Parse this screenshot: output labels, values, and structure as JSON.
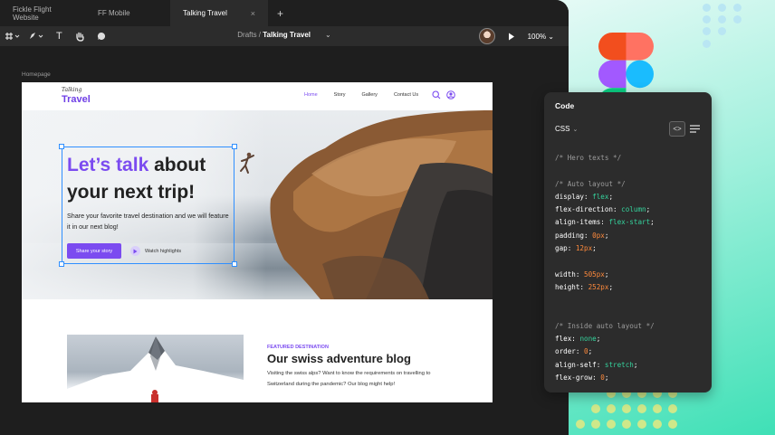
{
  "tabs": [
    {
      "label": "Fickle Flight Website"
    },
    {
      "label": "FF Mobile"
    },
    {
      "label": "Talking Travel",
      "active": true,
      "close": "×"
    }
  ],
  "tab_add": "+",
  "toolbar": {
    "breadcrumb_folder": "Drafts / ",
    "breadcrumb_file": "Talking Travel",
    "breadcrumb_chevron": "⌄",
    "zoom": "100%",
    "zoom_chevron": "⌄",
    "icons": [
      "frame-tool-icon",
      "pen-tool-icon",
      "text-tool-icon",
      "hand-tool-icon",
      "comment-tool-icon"
    ],
    "text_tool": "T"
  },
  "canvas": {
    "frame_label": "Homepage"
  },
  "site": {
    "logo_script": "Talking",
    "logo_main": "Travel",
    "nav": [
      "Home",
      "Story",
      "Gallery",
      "Contact Us"
    ],
    "hero_title_accent": "Let’s talk",
    "hero_title_rest": " about",
    "hero_title_line2": "your next trip!",
    "hero_subtitle": "Share your favorite travel destination and we will feature it in our next blog!",
    "cta_primary": "Share your story",
    "cta_secondary": "Watch highlights",
    "featured_tag": "FEATURED DESTINATION",
    "featured_title": "Our swiss adventure blog",
    "featured_body": "Visiting the swiss alps? Want to know the requirements on travelling to Switzerland during the pandemic? Our blog might help!"
  },
  "code_panel": {
    "title": "Code",
    "language": "CSS",
    "language_chevron": "⌄",
    "code_toggle": "<>",
    "lines": [
      [
        [
          "c",
          "/* Hero texts */"
        ]
      ],
      [],
      [
        [
          "c",
          "/* Auto layout */"
        ]
      ],
      [
        [
          "p",
          "display: "
        ],
        [
          "v",
          "flex"
        ],
        [
          "p",
          ";"
        ]
      ],
      [
        [
          "p",
          "flex-direction: "
        ],
        [
          "v",
          "column"
        ],
        [
          "p",
          ";"
        ]
      ],
      [
        [
          "p",
          "align-items: "
        ],
        [
          "v",
          "flex-start"
        ],
        [
          "p",
          ";"
        ]
      ],
      [
        [
          "p",
          "padding: "
        ],
        [
          "n",
          "0px"
        ],
        [
          "p",
          ";"
        ]
      ],
      [
        [
          "p",
          "gap: "
        ],
        [
          "n",
          "12px"
        ],
        [
          "p",
          ";"
        ]
      ],
      [],
      [
        [
          "p",
          "width: "
        ],
        [
          "n",
          "505px"
        ],
        [
          "p",
          ";"
        ]
      ],
      [
        [
          "p",
          "height: "
        ],
        [
          "n",
          "252px"
        ],
        [
          "p",
          ";"
        ]
      ],
      [],
      [],
      [
        [
          "c",
          "/* Inside auto layout */"
        ]
      ],
      [
        [
          "p",
          "flex: "
        ],
        [
          "v",
          "none"
        ],
        [
          "p",
          ";"
        ]
      ],
      [
        [
          "p",
          "order: "
        ],
        [
          "n",
          "0"
        ],
        [
          "p",
          ";"
        ]
      ],
      [
        [
          "p",
          "align-self: "
        ],
        [
          "v",
          "stretch"
        ],
        [
          "p",
          ";"
        ]
      ],
      [
        [
          "p",
          "flex-grow: "
        ],
        [
          "n",
          "0"
        ],
        [
          "p",
          ";"
        ]
      ]
    ]
  },
  "colors": {
    "accent": "#7b4bf0",
    "selection": "#2f8fff",
    "code_value": "#35d39d",
    "code_number": "#ff8a3c"
  }
}
